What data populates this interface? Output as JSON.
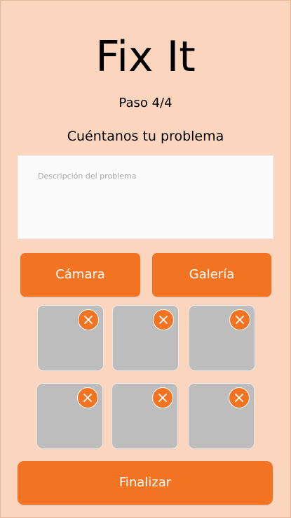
{
  "header": {
    "app_title": "Fix It",
    "step": "Paso 4/4",
    "subtitle": "Cuéntanos tu problema"
  },
  "description": {
    "placeholder": "Descripción del problema",
    "value": ""
  },
  "media_buttons": {
    "camera_label": "Cámara",
    "gallery_label": "Galería"
  },
  "photos": [
    {
      "name": "photo-1",
      "remove_icon": "close-icon"
    },
    {
      "name": "photo-2",
      "remove_icon": "close-icon"
    },
    {
      "name": "photo-3",
      "remove_icon": "close-icon"
    },
    {
      "name": "photo-4",
      "remove_icon": "close-icon"
    },
    {
      "name": "photo-5",
      "remove_icon": "close-icon"
    },
    {
      "name": "photo-6",
      "remove_icon": "close-icon"
    }
  ],
  "footer": {
    "finish_label": "Finalizar"
  },
  "colors": {
    "background": "#fcd5be",
    "accent": "#f27322",
    "thumb": "#bdbdbd",
    "input_bg": "#fafafa"
  }
}
